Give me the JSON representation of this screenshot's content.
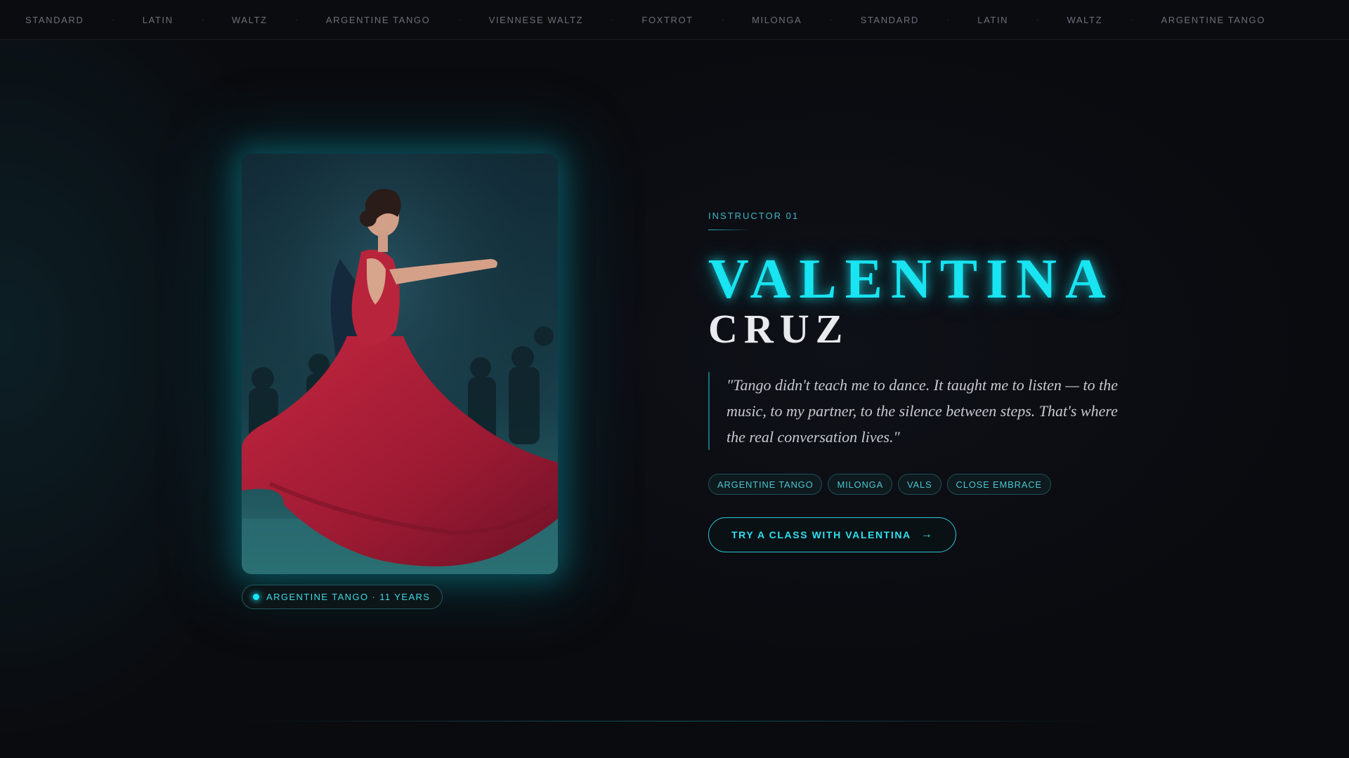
{
  "marquee": {
    "items": [
      "STANDARD",
      "LATIN",
      "WALTZ",
      "ARGENTINE TANGO",
      "VIENNESE WALTZ",
      "FOXTROT",
      "MILONGA",
      "STANDARD",
      "LATIN",
      "WALTZ",
      "ARGENTINE TANGO"
    ],
    "separator": "·"
  },
  "portrait": {
    "badge_label": "ARGENTINE TANGO · 11 YEARS"
  },
  "instructor": {
    "eyebrow": "INSTRUCTOR 01",
    "first_name": "VALENTINA",
    "last_name": "CRUZ",
    "quote": "\"Tango didn't teach me to dance. It taught me to listen — to the music, to my partner, to the silence between steps. That's where the real conversation lives.\"",
    "tags": [
      "ARGENTINE TANGO",
      "MILONGA",
      "VALS",
      "CLOSE EMBRACE"
    ],
    "cta_label": "TRY A CLASS WITH VALENTINA",
    "cta_icon": "→"
  },
  "colors": {
    "accent": "#18e4f2",
    "background": "#0a0b0f",
    "dress": "#b3203a"
  },
  "icons": {
    "badge": "status-dot-icon",
    "cta": "arrow-right-icon"
  }
}
